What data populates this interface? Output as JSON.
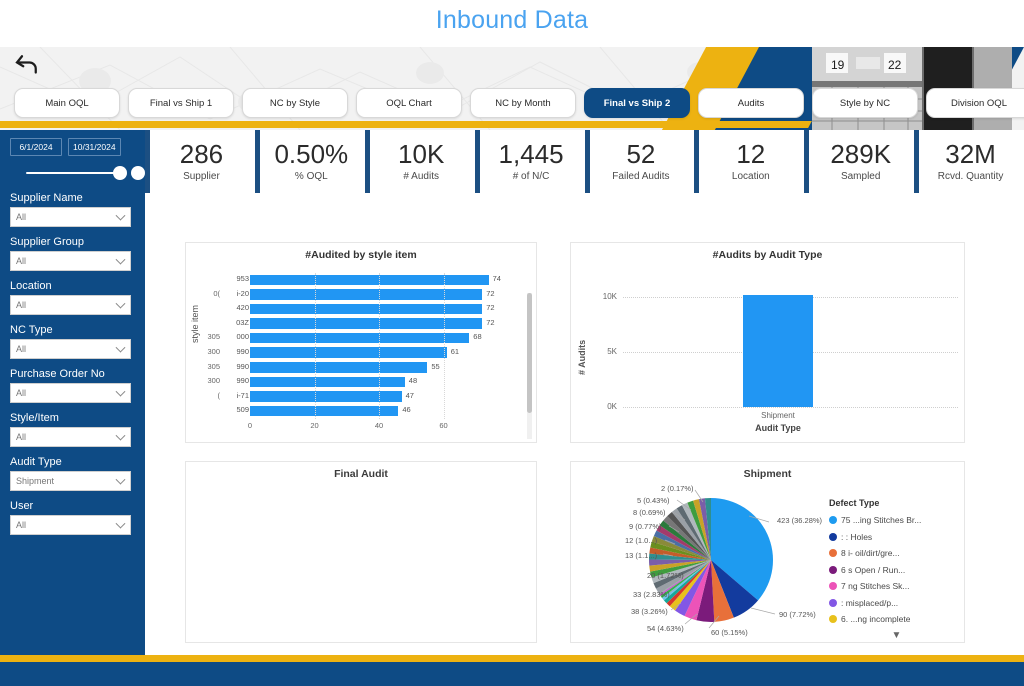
{
  "page": {
    "title": "Inbound Data"
  },
  "header": {
    "back_icon": "back-arrow-icon",
    "tabs": [
      {
        "label": "Main OQL",
        "active": false
      },
      {
        "label": "Final vs Ship 1",
        "active": false
      },
      {
        "label": "NC by Style",
        "active": false
      },
      {
        "label": "OQL Chart",
        "active": false
      },
      {
        "label": "NC by Month",
        "active": false
      },
      {
        "label": "Final vs Ship 2",
        "active": true
      },
      {
        "label": "Audits",
        "active": false
      },
      {
        "label": "Style by NC",
        "active": false
      },
      {
        "label": "Division OQL",
        "active": false
      }
    ]
  },
  "kpis": [
    {
      "value": "286",
      "label": "Supplier"
    },
    {
      "value": "0.50%",
      "label": "% OQL"
    },
    {
      "value": "10K",
      "label": "# Audits"
    },
    {
      "value": "1,445",
      "label": "# of N/C"
    },
    {
      "value": "52",
      "label": "Failed Audits"
    },
    {
      "value": "12",
      "label": "Location"
    },
    {
      "value": "289K",
      "label": "Sampled"
    },
    {
      "value": "32M",
      "label": "Rcvd. Quantity"
    }
  ],
  "sidebar": {
    "date_from": "6/1/2024",
    "date_to": "10/31/2024",
    "filters": [
      {
        "label": "Supplier Name",
        "value": "All"
      },
      {
        "label": "Supplier Group",
        "value": "All"
      },
      {
        "label": "Location",
        "value": "All"
      },
      {
        "label": "NC Type",
        "value": "All"
      },
      {
        "label": "Purchase Order No",
        "value": "All"
      },
      {
        "label": "Style/Item",
        "value": "All"
      },
      {
        "label": "Audit Type",
        "value": "Shipment"
      },
      {
        "label": "User",
        "value": "All"
      }
    ]
  },
  "cards": {
    "bar_title": "#Audited by style item",
    "col_title": "#Audits by Audit Type",
    "final_title": "Final Audit",
    "pie_title": "Shipment"
  },
  "chart_data": [
    {
      "type": "bar",
      "title": "#Audited by style item",
      "orientation": "horizontal",
      "xlabel": "",
      "ylabel": "style item",
      "xlim": [
        0,
        80
      ],
      "xticks": [
        0,
        20,
        40,
        60
      ],
      "grid": true,
      "categories": [
        "953",
        "i-20",
        "420",
        "03Z",
        "000",
        "990",
        "990",
        "990",
        "i-71",
        "509"
      ],
      "categories_prefix": [
        "",
        "0(",
        "",
        "",
        "305",
        "300",
        "305",
        "300",
        "(",
        ""
      ],
      "values": [
        74,
        72,
        72,
        72,
        68,
        61,
        55,
        48,
        47,
        46
      ],
      "color": "#2196f3",
      "scrollable": true
    },
    {
      "type": "bar",
      "title": "#Audits by Audit Type",
      "orientation": "vertical",
      "xlabel": "Audit Type",
      "ylabel": "# Audits",
      "categories": [
        "Shipment"
      ],
      "values": [
        10200
      ],
      "ylim": [
        0,
        11500
      ],
      "yticks": [
        0,
        5000,
        10000
      ],
      "ytick_labels": [
        "0K",
        "5K",
        "10K"
      ],
      "grid": true,
      "color": "#2196f3"
    },
    {
      "type": "pie",
      "title": "Shipment",
      "legend_title": "Defect Type",
      "legend_position": "right",
      "total": 1166,
      "slices": [
        {
          "label": "423 (36.28%)",
          "value": 423,
          "pct": 36.28,
          "color": "#1e9bf0"
        },
        {
          "label": "90 (7.72%)",
          "value": 90,
          "pct": 7.72,
          "color": "#133b9e"
        },
        {
          "label": "60 (5.15%)",
          "value": 60,
          "pct": 5.15,
          "color": "#e8703a"
        },
        {
          "label": "54 (4.63%)",
          "value": 54,
          "pct": 4.63,
          "color": "#7b1b7b"
        },
        {
          "label": "38 (3.26%)",
          "value": 38,
          "pct": 3.26,
          "color": "#ec53b8"
        },
        {
          "label": "33 (2.83%)",
          "value": 33,
          "pct": 2.83,
          "color": "#8257e5"
        },
        {
          "label": "20 (1.72%)",
          "value": 20,
          "pct": 1.72,
          "color": "#e8c11c"
        },
        {
          "label": "13 (1.1...)",
          "value": 13,
          "pct": 1.11,
          "color": "#d6372b"
        },
        {
          "label": "12 (1.0...)",
          "value": 12,
          "pct": 1.03,
          "color": "#17a89a"
        },
        {
          "label": "9 (0.77%)",
          "value": 9,
          "pct": 0.77,
          "color": "#6ec4ea"
        },
        {
          "label": "8 (0.69%)",
          "value": 8,
          "pct": 0.69,
          "color": "#35b44a"
        },
        {
          "label": "5 (0.43%)",
          "value": 5,
          "pct": 0.43,
          "color": "#c95ad1"
        },
        {
          "label": "2 (0.17%)",
          "value": 2,
          "pct": 0.17,
          "color": "#9aa0a6"
        }
      ],
      "legend_entries": [
        {
          "text": "75 ...ing Stitches Br...",
          "color": "#1e9bf0"
        },
        {
          "text": ":          : Holes",
          "color": "#133b9e"
        },
        {
          "text": "8        i- oil/dirt/gre...",
          "color": "#e8703a"
        },
        {
          "text": "6        s Open / Run...",
          "color": "#7b1b7b"
        },
        {
          "text": "7        ng Stitches Sk...",
          "color": "#ec53b8"
        },
        {
          "text": ":        misplaced/p...",
          "color": "#8257e5"
        },
        {
          "text": "6.      ...ng incomplete",
          "color": "#e8c11c"
        }
      ],
      "legend_more_icon": "chevron-down-icon"
    }
  ],
  "colors": {
    "brand_blue": "#0e4b85",
    "brand_yellow": "#edb211",
    "accent_blue": "#2196f3",
    "title_blue": "#4aa3f0"
  }
}
